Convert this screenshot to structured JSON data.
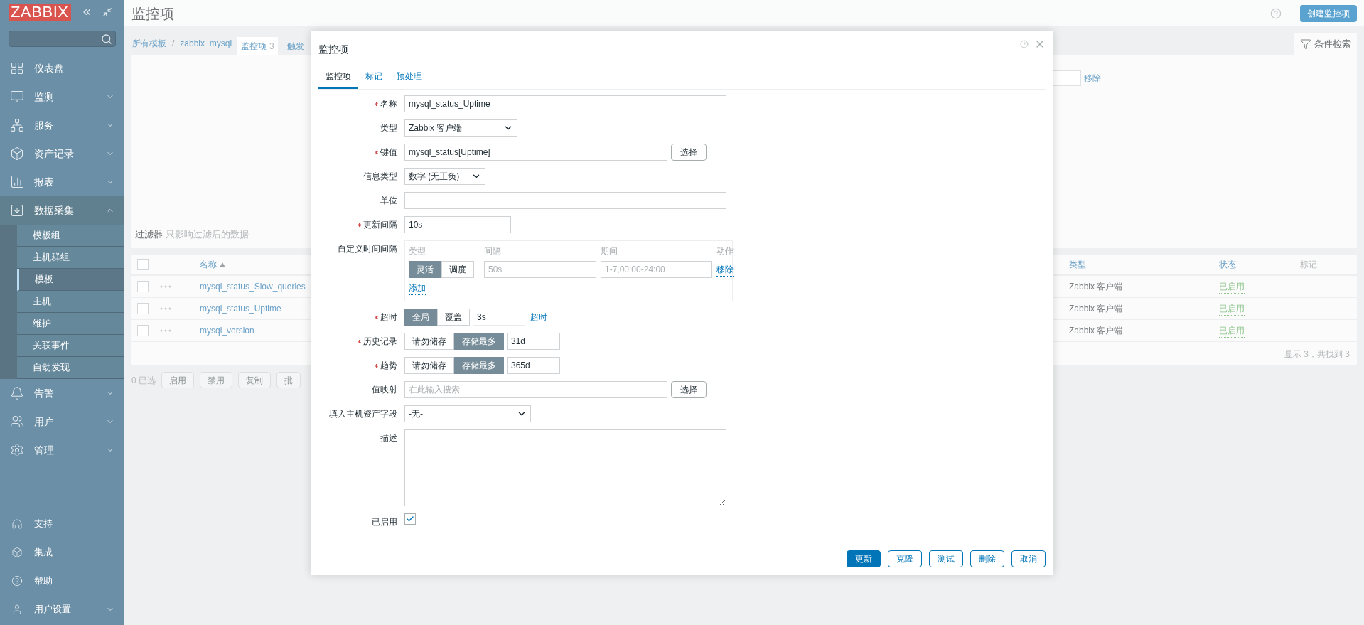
{
  "sidebar": {
    "logo": "ZABBIX",
    "items": [
      {
        "label": "仪表盘"
      },
      {
        "label": "监测",
        "expanded": false
      },
      {
        "label": "服务",
        "expanded": false
      },
      {
        "label": "资产记录",
        "expanded": false
      },
      {
        "label": "报表",
        "expanded": false
      },
      {
        "label": "数据采集",
        "expanded": true,
        "children": [
          {
            "label": "模板组",
            "selected": false
          },
          {
            "label": "主机群组",
            "selected": false
          },
          {
            "label": "模板",
            "selected": true
          },
          {
            "label": "主机",
            "selected": false
          },
          {
            "label": "维护",
            "selected": false
          },
          {
            "label": "关联事件",
            "selected": false
          },
          {
            "label": "自动发现",
            "selected": false
          }
        ]
      },
      {
        "label": "告警",
        "expanded": false
      },
      {
        "label": "用户",
        "expanded": false
      },
      {
        "label": "管理",
        "expanded": false
      }
    ],
    "bottom_items": [
      {
        "label": "支持"
      },
      {
        "label": "集成"
      },
      {
        "label": "帮助"
      },
      {
        "label": "用户设置",
        "expanded": false
      }
    ]
  },
  "page": {
    "title": "监控项",
    "create_button": "创建监控项",
    "breadcrumbs": [
      "所有模板",
      "zabbix_mysql"
    ],
    "breadcrumb_separator": "/",
    "tabs": [
      {
        "label": "监控项",
        "count": "3",
        "selected": true
      },
      {
        "label": "触发",
        "selected": false
      }
    ],
    "filter_tab": "条件检索",
    "filter_remove": "移除",
    "filter_title": "过滤器",
    "filter_note": "只影响过滤后的数据",
    "table": {
      "select_all_checked": false,
      "columns": [
        {
          "label": "名称",
          "sorted": true
        },
        {
          "label": "类型",
          "sorted": false
        },
        {
          "label": "状态",
          "sorted": false
        },
        {
          "label": "标记",
          "sorted": false
        }
      ],
      "rows": [
        {
          "name": "mysql_status_Slow_queries",
          "type": "Zabbix 客户端",
          "status": "已启用",
          "checked": false
        },
        {
          "name": "mysql_status_Uptime",
          "type": "Zabbix 客户端",
          "status": "已启用",
          "checked": false
        },
        {
          "name": "mysql_version",
          "type": "Zabbix 客户端",
          "status": "已启用",
          "checked": false
        }
      ],
      "footer": "显示 3，共找到 3"
    },
    "selected_count": "0 已选",
    "mass_buttons": [
      {
        "label": "启用",
        "disabled": true
      },
      {
        "label": "禁用",
        "disabled": true
      },
      {
        "label": "复制",
        "disabled": true
      },
      {
        "label": "批",
        "disabled": true
      }
    ]
  },
  "dialog": {
    "title": "监控项",
    "tabs": [
      {
        "label": "监控项",
        "selected": true
      },
      {
        "label": "标记",
        "selected": false
      },
      {
        "label": "预处理",
        "selected": false
      }
    ],
    "fields": [
      {
        "kind": "text",
        "label": "名称",
        "required": true,
        "value": "mysql_status_Uptime"
      },
      {
        "kind": "select",
        "label": "类型",
        "required": false,
        "value": "Zabbix 客户端"
      },
      {
        "kind": "text",
        "label": "键值",
        "required": true,
        "value": "mysql_status[Uptime]",
        "button": "选择"
      },
      {
        "kind": "select",
        "label": "信息类型",
        "required": false,
        "value": "数字 (无正负)"
      },
      {
        "kind": "text",
        "label": "单位",
        "required": false
      },
      {
        "kind": "text",
        "label": "更新间隔",
        "required": true,
        "value": "10s"
      },
      {
        "kind": "intervals",
        "label": "自定义时间间隔",
        "required": false,
        "headers": [
          "类型",
          "间隔",
          "期间",
          "动作"
        ],
        "rows": [
          {
            "modes": [
              {
                "label": "灵活",
                "selected": true
              },
              {
                "label": "调度",
                "selected": false
              }
            ],
            "interval_placeholder": "50s",
            "period_placeholder": "1-7,00:00-24:00",
            "remove": "移除"
          }
        ],
        "add": "添加"
      },
      {
        "kind": "timeout",
        "label": "超时",
        "required": true,
        "modes": [
          {
            "label": "全局",
            "selected": true
          },
          {
            "label": "覆盖",
            "selected": false
          }
        ],
        "value": "3s",
        "disabled": true,
        "link": "超时"
      },
      {
        "kind": "storage",
        "label": "历史记录",
        "required": true,
        "modes": [
          {
            "label": "请勿储存",
            "selected": false
          },
          {
            "label": "存储最多",
            "selected": true
          }
        ],
        "value": "31d"
      },
      {
        "kind": "storage",
        "label": "趋势",
        "required": true,
        "modes": [
          {
            "label": "请勿储存",
            "selected": false
          },
          {
            "label": "存储最多",
            "selected": true
          }
        ],
        "value": "365d"
      },
      {
        "kind": "text",
        "label": "值映射",
        "required": false,
        "placeholder": "在此输入搜索",
        "button": "选择"
      },
      {
        "kind": "select",
        "label": "填入主机资产字段",
        "required": false,
        "value": "-无-"
      },
      {
        "kind": "textarea",
        "label": "描述",
        "required": false
      },
      {
        "kind": "checkbox",
        "label": "已启用",
        "required": false,
        "checked": true
      }
    ],
    "buttons": [
      {
        "label": "更新",
        "primary": true
      },
      {
        "label": "克隆",
        "primary": false
      },
      {
        "label": "测试",
        "primary": false
      },
      {
        "label": "删除",
        "primary": false
      },
      {
        "label": "取消",
        "primary": false
      }
    ]
  }
}
